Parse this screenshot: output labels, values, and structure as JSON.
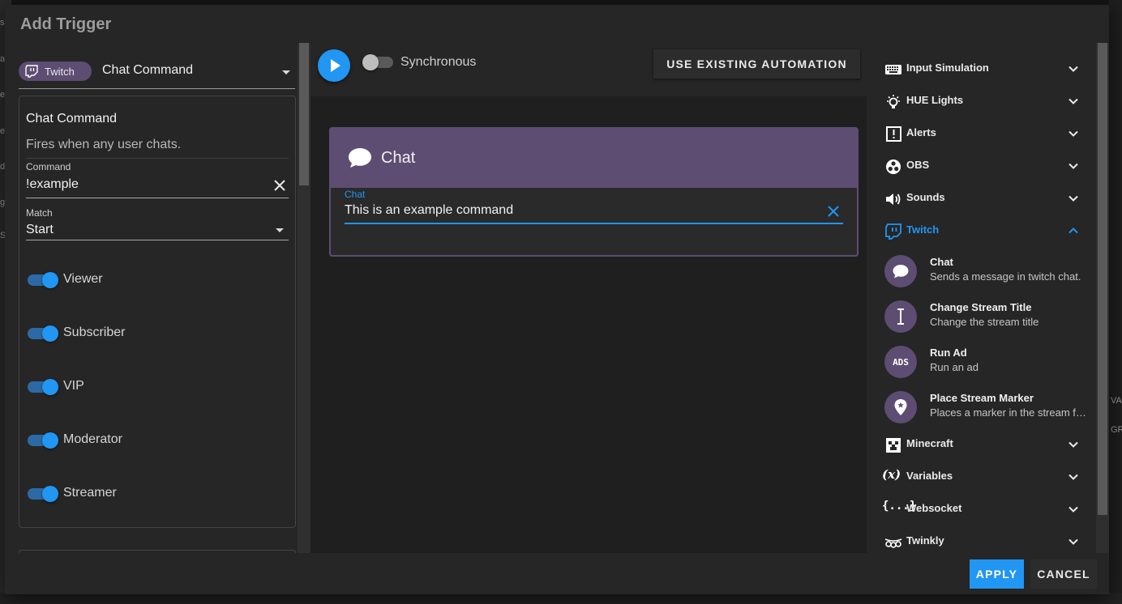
{
  "background": {
    "left_fragments": [
      "s",
      "at",
      "en",
      "es",
      "ds",
      "gs",
      "Sc"
    ],
    "right_fragments": [
      "VA",
      "GR"
    ]
  },
  "dialog": {
    "title": "Add Trigger"
  },
  "trigger": {
    "chip_label": "Twitch",
    "name": "Chat Command",
    "card_title": "Chat Command",
    "card_description": "Fires when any user chats.",
    "command_label": "Command",
    "command_value": "!example",
    "match_label": "Match",
    "match_value": "Start",
    "toggles": [
      {
        "label": "Viewer",
        "on": true
      },
      {
        "label": "Subscriber",
        "on": true
      },
      {
        "label": "VIP",
        "on": true
      },
      {
        "label": "Moderator",
        "on": true
      },
      {
        "label": "Streamer",
        "on": true
      }
    ]
  },
  "toolbar": {
    "sync_label": "Synchronous",
    "sync_on": false,
    "use_existing_label": "USE EXISTING AUTOMATION"
  },
  "action_card": {
    "title": "Chat",
    "field_label": "Chat",
    "field_value": "This is an example command"
  },
  "categories": [
    {
      "name": "Input Simulation",
      "icon": "keyboard-icon",
      "expanded": false
    },
    {
      "name": "HUE Lights",
      "icon": "lightbulb-icon",
      "expanded": false
    },
    {
      "name": "Alerts",
      "icon": "alert-box-icon",
      "expanded": false
    },
    {
      "name": "OBS",
      "icon": "obs-icon",
      "expanded": false
    },
    {
      "name": "Sounds",
      "icon": "speaker-icon",
      "expanded": false
    },
    {
      "name": "Twitch",
      "icon": "twitch-icon",
      "expanded": true
    },
    {
      "name": "Minecraft",
      "icon": "minecraft-icon",
      "expanded": false
    },
    {
      "name": "Variables",
      "icon": "variable-icon",
      "expanded": false
    },
    {
      "name": "Websocket",
      "icon": "websocket-icon",
      "expanded": false
    },
    {
      "name": "Twinkly",
      "icon": "twinkly-icon",
      "expanded": false
    }
  ],
  "twitch_actions": [
    {
      "title": "Chat",
      "description": "Sends a message in twitch chat.",
      "icon": "chat-bubble-icon"
    },
    {
      "title": "Change Stream Title",
      "description": "Change the stream title",
      "icon": "text-cursor-icon"
    },
    {
      "title": "Run Ad",
      "description": "Run an ad",
      "icon": "ads-icon"
    },
    {
      "title": "Place Stream Marker",
      "description": "Places a marker in the stream for highlights",
      "icon": "map-marker-icon"
    }
  ],
  "footer": {
    "apply_label": "APPLY",
    "cancel_label": "CANCEL"
  },
  "colors": {
    "accent": "#2196f3",
    "twitch_purple": "#5d4d72"
  }
}
